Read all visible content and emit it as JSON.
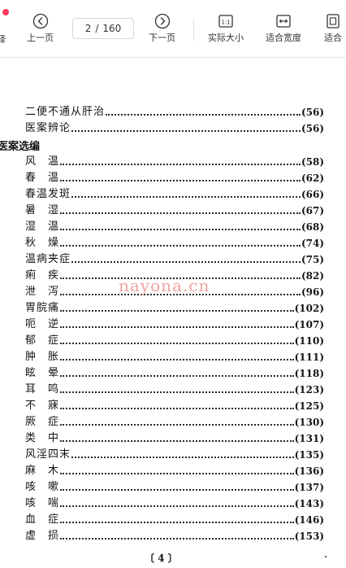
{
  "toolbar": {
    "select_label": "择",
    "prev_label": "上一页",
    "next_label": "下一页",
    "actual_size_label": "实际大小",
    "fit_width_label": "适合宽度",
    "fit_page_label": "适合",
    "current_page": "2",
    "page_separator": "/",
    "total_pages": "160",
    "actual_size_icon_text": "1:1",
    "recording_color": "#ff3b5c",
    "icons": {
      "prev": "chevron-left-circle-icon",
      "next": "chevron-right-circle-icon",
      "actual_size": "actual-size-icon",
      "fit_width": "fit-width-icon",
      "fit_page": "fit-page-icon"
    }
  },
  "document": {
    "section_heading": "医案选编",
    "entries_before": [
      {
        "title": "二便不通从肝治",
        "page": "(56)"
      },
      {
        "title": "医案辨论",
        "page": "(56)"
      }
    ],
    "entries": [
      {
        "title": "风　温",
        "page": "(58)"
      },
      {
        "title": "春　温",
        "page": "(62)"
      },
      {
        "title": "春温发斑",
        "page": "(66)"
      },
      {
        "title": "暑　湿",
        "page": "(67)"
      },
      {
        "title": "湿　温",
        "page": "(68)"
      },
      {
        "title": "秋　燥",
        "page": "(74)"
      },
      {
        "title": "温病夹症",
        "page": "(75)"
      },
      {
        "title": "痢　疾",
        "page": "(82)"
      },
      {
        "title": "泄　泻",
        "page": "(96)"
      },
      {
        "title": "胃脘痛",
        "page": "(102)"
      },
      {
        "title": "呃　逆",
        "page": "(107)"
      },
      {
        "title": "郁　症",
        "page": "(110)"
      },
      {
        "title": "肿　胀",
        "page": "(111)"
      },
      {
        "title": "眩　晕",
        "page": "(118)"
      },
      {
        "title": "耳　鸣",
        "page": "(123)"
      },
      {
        "title": "不　寐",
        "page": "(125)"
      },
      {
        "title": "厥　症",
        "page": "(130)"
      },
      {
        "title": "类　中",
        "page": "(131)"
      },
      {
        "title": "风淫四末",
        "page": "(135)"
      },
      {
        "title": "麻　木",
        "page": "(136)"
      },
      {
        "title": "咳　嗽",
        "page": "(137)"
      },
      {
        "title": "咳　喘",
        "page": "(143)"
      },
      {
        "title": "血　症",
        "page": "(146)"
      },
      {
        "title": "虚　损",
        "page": "(153)"
      }
    ],
    "watermark": "nayona.cn",
    "page_number": "〔 4 〕"
  }
}
